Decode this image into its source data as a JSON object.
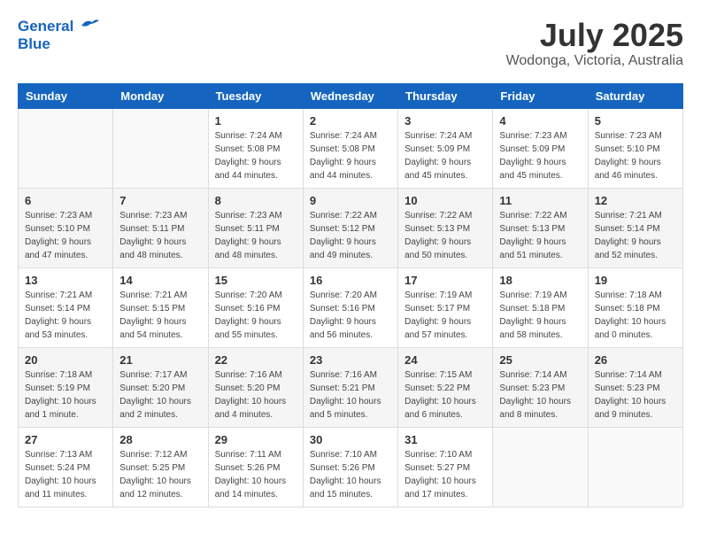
{
  "header": {
    "logo_line1": "General",
    "logo_line2": "Blue",
    "month_title": "July 2025",
    "location": "Wodonga, Victoria, Australia"
  },
  "days_of_week": [
    "Sunday",
    "Monday",
    "Tuesday",
    "Wednesday",
    "Thursday",
    "Friday",
    "Saturday"
  ],
  "weeks": [
    [
      {
        "day": "",
        "sunrise": "",
        "sunset": "",
        "daylight": ""
      },
      {
        "day": "",
        "sunrise": "",
        "sunset": "",
        "daylight": ""
      },
      {
        "day": "1",
        "sunrise": "Sunrise: 7:24 AM",
        "sunset": "Sunset: 5:08 PM",
        "daylight": "Daylight: 9 hours and 44 minutes."
      },
      {
        "day": "2",
        "sunrise": "Sunrise: 7:24 AM",
        "sunset": "Sunset: 5:08 PM",
        "daylight": "Daylight: 9 hours and 44 minutes."
      },
      {
        "day": "3",
        "sunrise": "Sunrise: 7:24 AM",
        "sunset": "Sunset: 5:09 PM",
        "daylight": "Daylight: 9 hours and 45 minutes."
      },
      {
        "day": "4",
        "sunrise": "Sunrise: 7:23 AM",
        "sunset": "Sunset: 5:09 PM",
        "daylight": "Daylight: 9 hours and 45 minutes."
      },
      {
        "day": "5",
        "sunrise": "Sunrise: 7:23 AM",
        "sunset": "Sunset: 5:10 PM",
        "daylight": "Daylight: 9 hours and 46 minutes."
      }
    ],
    [
      {
        "day": "6",
        "sunrise": "Sunrise: 7:23 AM",
        "sunset": "Sunset: 5:10 PM",
        "daylight": "Daylight: 9 hours and 47 minutes."
      },
      {
        "day": "7",
        "sunrise": "Sunrise: 7:23 AM",
        "sunset": "Sunset: 5:11 PM",
        "daylight": "Daylight: 9 hours and 48 minutes."
      },
      {
        "day": "8",
        "sunrise": "Sunrise: 7:23 AM",
        "sunset": "Sunset: 5:11 PM",
        "daylight": "Daylight: 9 hours and 48 minutes."
      },
      {
        "day": "9",
        "sunrise": "Sunrise: 7:22 AM",
        "sunset": "Sunset: 5:12 PM",
        "daylight": "Daylight: 9 hours and 49 minutes."
      },
      {
        "day": "10",
        "sunrise": "Sunrise: 7:22 AM",
        "sunset": "Sunset: 5:13 PM",
        "daylight": "Daylight: 9 hours and 50 minutes."
      },
      {
        "day": "11",
        "sunrise": "Sunrise: 7:22 AM",
        "sunset": "Sunset: 5:13 PM",
        "daylight": "Daylight: 9 hours and 51 minutes."
      },
      {
        "day": "12",
        "sunrise": "Sunrise: 7:21 AM",
        "sunset": "Sunset: 5:14 PM",
        "daylight": "Daylight: 9 hours and 52 minutes."
      }
    ],
    [
      {
        "day": "13",
        "sunrise": "Sunrise: 7:21 AM",
        "sunset": "Sunset: 5:14 PM",
        "daylight": "Daylight: 9 hours and 53 minutes."
      },
      {
        "day": "14",
        "sunrise": "Sunrise: 7:21 AM",
        "sunset": "Sunset: 5:15 PM",
        "daylight": "Daylight: 9 hours and 54 minutes."
      },
      {
        "day": "15",
        "sunrise": "Sunrise: 7:20 AM",
        "sunset": "Sunset: 5:16 PM",
        "daylight": "Daylight: 9 hours and 55 minutes."
      },
      {
        "day": "16",
        "sunrise": "Sunrise: 7:20 AM",
        "sunset": "Sunset: 5:16 PM",
        "daylight": "Daylight: 9 hours and 56 minutes."
      },
      {
        "day": "17",
        "sunrise": "Sunrise: 7:19 AM",
        "sunset": "Sunset: 5:17 PM",
        "daylight": "Daylight: 9 hours and 57 minutes."
      },
      {
        "day": "18",
        "sunrise": "Sunrise: 7:19 AM",
        "sunset": "Sunset: 5:18 PM",
        "daylight": "Daylight: 9 hours and 58 minutes."
      },
      {
        "day": "19",
        "sunrise": "Sunrise: 7:18 AM",
        "sunset": "Sunset: 5:18 PM",
        "daylight": "Daylight: 10 hours and 0 minutes."
      }
    ],
    [
      {
        "day": "20",
        "sunrise": "Sunrise: 7:18 AM",
        "sunset": "Sunset: 5:19 PM",
        "daylight": "Daylight: 10 hours and 1 minute."
      },
      {
        "day": "21",
        "sunrise": "Sunrise: 7:17 AM",
        "sunset": "Sunset: 5:20 PM",
        "daylight": "Daylight: 10 hours and 2 minutes."
      },
      {
        "day": "22",
        "sunrise": "Sunrise: 7:16 AM",
        "sunset": "Sunset: 5:20 PM",
        "daylight": "Daylight: 10 hours and 4 minutes."
      },
      {
        "day": "23",
        "sunrise": "Sunrise: 7:16 AM",
        "sunset": "Sunset: 5:21 PM",
        "daylight": "Daylight: 10 hours and 5 minutes."
      },
      {
        "day": "24",
        "sunrise": "Sunrise: 7:15 AM",
        "sunset": "Sunset: 5:22 PM",
        "daylight": "Daylight: 10 hours and 6 minutes."
      },
      {
        "day": "25",
        "sunrise": "Sunrise: 7:14 AM",
        "sunset": "Sunset: 5:23 PM",
        "daylight": "Daylight: 10 hours and 8 minutes."
      },
      {
        "day": "26",
        "sunrise": "Sunrise: 7:14 AM",
        "sunset": "Sunset: 5:23 PM",
        "daylight": "Daylight: 10 hours and 9 minutes."
      }
    ],
    [
      {
        "day": "27",
        "sunrise": "Sunrise: 7:13 AM",
        "sunset": "Sunset: 5:24 PM",
        "daylight": "Daylight: 10 hours and 11 minutes."
      },
      {
        "day": "28",
        "sunrise": "Sunrise: 7:12 AM",
        "sunset": "Sunset: 5:25 PM",
        "daylight": "Daylight: 10 hours and 12 minutes."
      },
      {
        "day": "29",
        "sunrise": "Sunrise: 7:11 AM",
        "sunset": "Sunset: 5:26 PM",
        "daylight": "Daylight: 10 hours and 14 minutes."
      },
      {
        "day": "30",
        "sunrise": "Sunrise: 7:10 AM",
        "sunset": "Sunset: 5:26 PM",
        "daylight": "Daylight: 10 hours and 15 minutes."
      },
      {
        "day": "31",
        "sunrise": "Sunrise: 7:10 AM",
        "sunset": "Sunset: 5:27 PM",
        "daylight": "Daylight: 10 hours and 17 minutes."
      },
      {
        "day": "",
        "sunrise": "",
        "sunset": "",
        "daylight": ""
      },
      {
        "day": "",
        "sunrise": "",
        "sunset": "",
        "daylight": ""
      }
    ]
  ]
}
